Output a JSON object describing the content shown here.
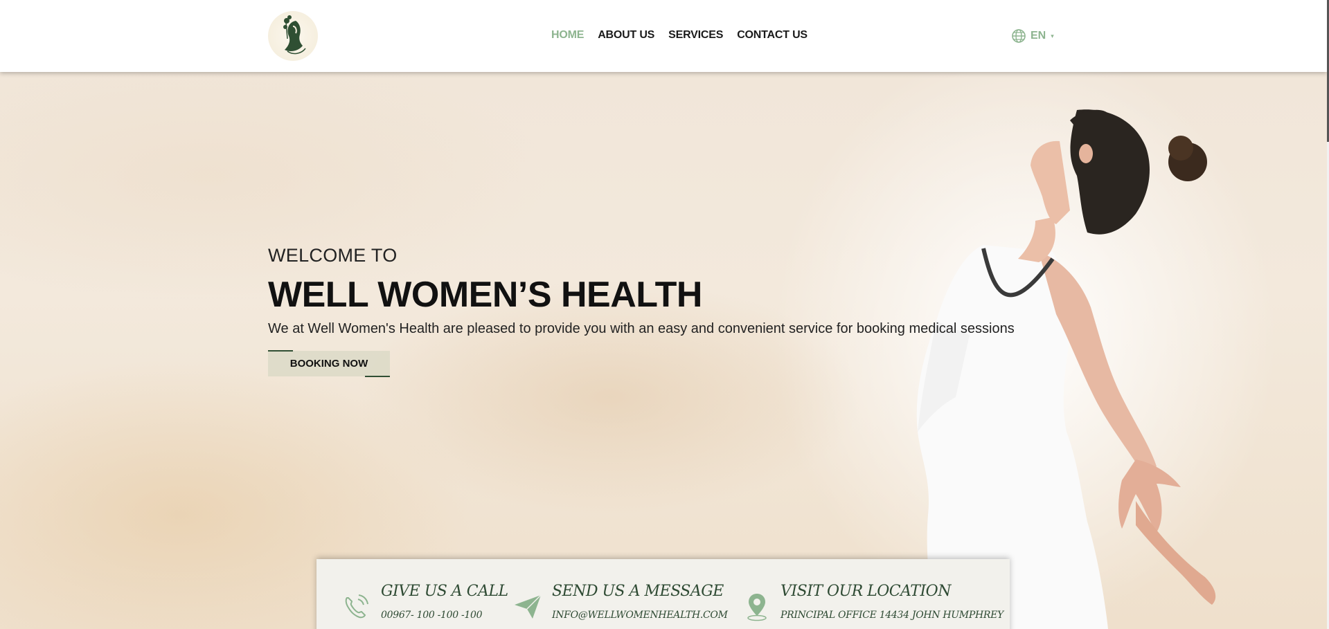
{
  "header": {
    "logo_alt": "logo",
    "nav": [
      {
        "label": "HOME",
        "active": true
      },
      {
        "label": "ABOUT US",
        "active": false
      },
      {
        "label": "SERVICES",
        "active": false
      },
      {
        "label": "CONTACT US",
        "active": false
      }
    ],
    "language": {
      "icon": "globe-icon",
      "label": "EN",
      "caret": "▾"
    }
  },
  "hero": {
    "welcome": "WELCOME TO",
    "title": "WELL WOMEN’S HEALTH",
    "subtitle": "We at Well Women's Health are pleased to provide you with an easy and convenient service for booking medical sessions",
    "button_label": "BOOKING NOW"
  },
  "contact": [
    {
      "icon": "phone-icon",
      "heading": "GIVE US A CALL",
      "text": "00967- 100 -100 -100"
    },
    {
      "icon": "paper-plane-icon",
      "heading": "SEND US A MESSAGE",
      "text": "INFO@WELLWOMENHEALTH.COM"
    },
    {
      "icon": "location-pin-icon",
      "heading": "VISIT OUR LOCATION",
      "text": "PRINCIPAL OFFICE 14434 JOHN HUMPHREY"
    }
  ],
  "colors": {
    "accent": "#8db48f",
    "dark_green": "#2e4a33",
    "text": "#111111"
  }
}
